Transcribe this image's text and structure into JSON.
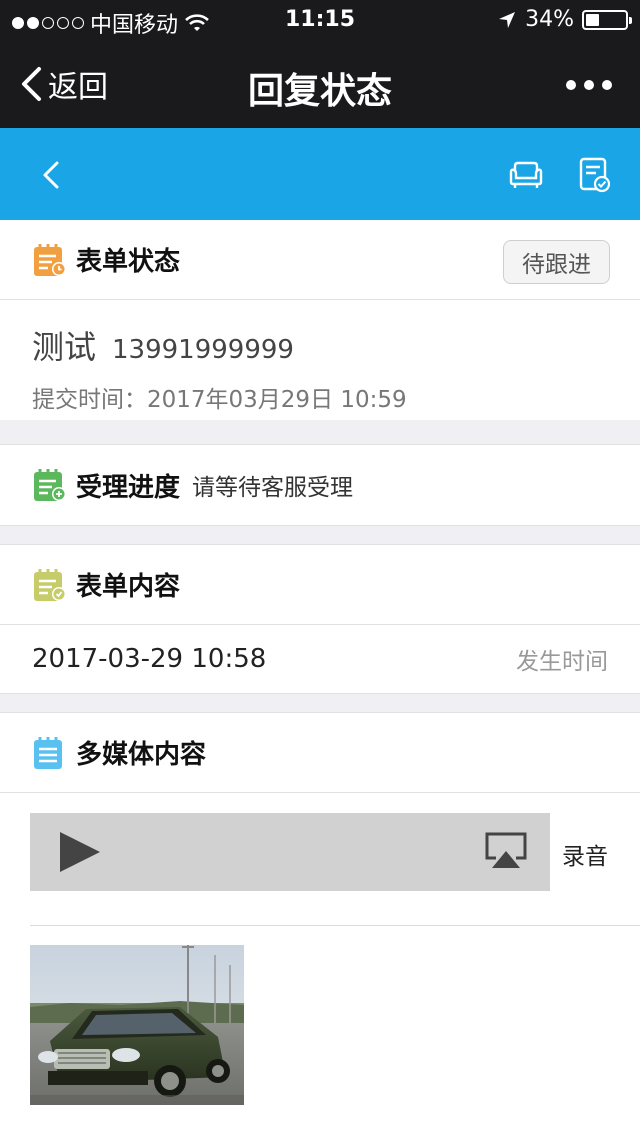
{
  "status_bar": {
    "carrier": "中国移动",
    "time": "11:15",
    "battery": "34%"
  },
  "nav": {
    "back_label": "返回",
    "title": "回复状态"
  },
  "form_status": {
    "title": "表单状态",
    "badge": "待跟进",
    "name": "测试",
    "phone": "13991999999",
    "submit_label": "提交时间：",
    "submit_time": "2017年03月29日 10:59"
  },
  "progress": {
    "title": "受理进度",
    "status": "请等待客服受理"
  },
  "form_content": {
    "title": "表单内容",
    "value": "2017-03-29 10:58",
    "label": "发生时间"
  },
  "multimedia": {
    "title": "多媒体内容",
    "audio_label": "录音"
  },
  "colors": {
    "app_blue": "#1aa6e6",
    "icon_orange": "#f0a040",
    "icon_green": "#5cb85c",
    "icon_olive": "#c6cc6a",
    "icon_sky": "#59c1f0"
  },
  "icons": [
    "wifi-icon",
    "location-arrow-icon",
    "back-chevron-icon",
    "more-icon",
    "chair-icon",
    "checklist-icon",
    "play-icon",
    "airplay-icon"
  ]
}
